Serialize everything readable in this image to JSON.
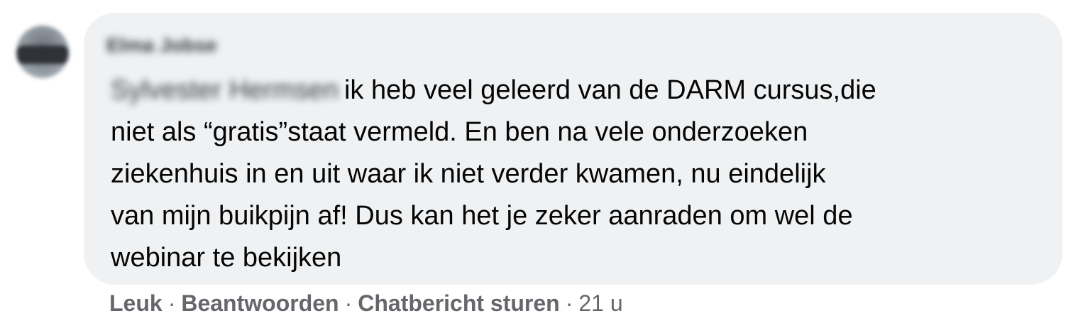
{
  "comment": {
    "author_name": "Elma Jobse",
    "mention_name": "Sylvester Hermsen",
    "text_lines": [
      "ik heb veel geleerd van de DARM cursus,die",
      "niet als “gratis”staat vermeld. En ben na vele onderzoeken",
      "ziekenhuis in en uit waar ik niet verder kwamen, nu eindelijk",
      "van mijn buikpijn af! Dus kan het je zeker aanraden om wel de",
      "webinar te bekijken"
    ]
  },
  "actions": {
    "like_label": "Leuk",
    "reply_label": "Beantwoorden",
    "message_label": "Chatbericht sturen",
    "separator": "·",
    "timestamp": "21 u"
  }
}
